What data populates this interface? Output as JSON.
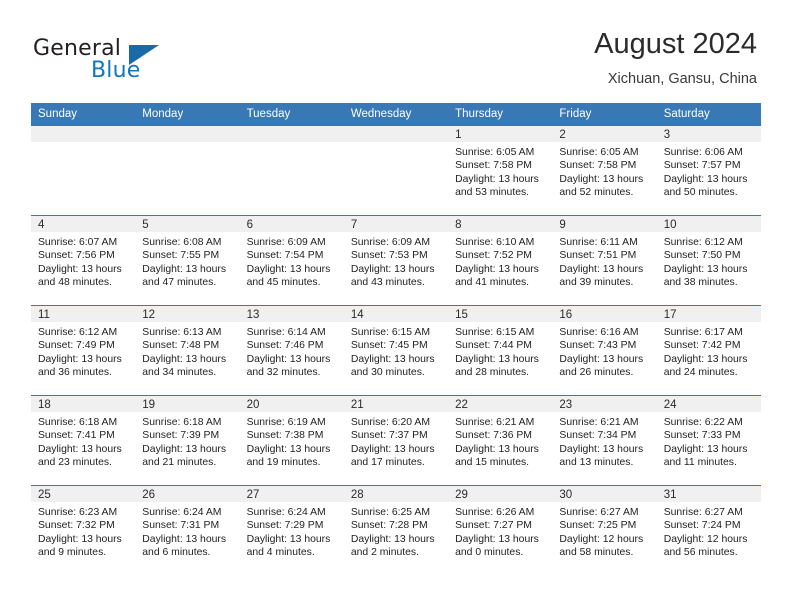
{
  "brand": {
    "name_part1": "General",
    "name_part2": "Blue",
    "colors": {
      "dark": "#231f20",
      "blue": "#1277bc",
      "triangle": "#1a6aa8"
    }
  },
  "header": {
    "title": "August 2024",
    "location": "Xichuan, Gansu, China"
  },
  "theme": {
    "header_row_bg": "#3878b4",
    "daynum_band_bg": "#f0f0f0",
    "row_divider": "#3878b4"
  },
  "weekdays": [
    "Sunday",
    "Monday",
    "Tuesday",
    "Wednesday",
    "Thursday",
    "Friday",
    "Saturday"
  ],
  "labels": {
    "sunrise_prefix": "Sunrise:",
    "sunset_prefix": "Sunset:",
    "daylight_prefix": "Daylight:"
  },
  "weeks": [
    [
      {
        "empty": true
      },
      {
        "empty": true
      },
      {
        "empty": true
      },
      {
        "empty": true
      },
      {
        "day": "1",
        "sunrise": "Sunrise: 6:05 AM",
        "sunset": "Sunset: 7:58 PM",
        "daylight_line1": "Daylight: 13 hours",
        "daylight_line2": "and 53 minutes."
      },
      {
        "day": "2",
        "sunrise": "Sunrise: 6:05 AM",
        "sunset": "Sunset: 7:58 PM",
        "daylight_line1": "Daylight: 13 hours",
        "daylight_line2": "and 52 minutes."
      },
      {
        "day": "3",
        "sunrise": "Sunrise: 6:06 AM",
        "sunset": "Sunset: 7:57 PM",
        "daylight_line1": "Daylight: 13 hours",
        "daylight_line2": "and 50 minutes."
      }
    ],
    [
      {
        "day": "4",
        "sunrise": "Sunrise: 6:07 AM",
        "sunset": "Sunset: 7:56 PM",
        "daylight_line1": "Daylight: 13 hours",
        "daylight_line2": "and 48 minutes."
      },
      {
        "day": "5",
        "sunrise": "Sunrise: 6:08 AM",
        "sunset": "Sunset: 7:55 PM",
        "daylight_line1": "Daylight: 13 hours",
        "daylight_line2": "and 47 minutes."
      },
      {
        "day": "6",
        "sunrise": "Sunrise: 6:09 AM",
        "sunset": "Sunset: 7:54 PM",
        "daylight_line1": "Daylight: 13 hours",
        "daylight_line2": "and 45 minutes."
      },
      {
        "day": "7",
        "sunrise": "Sunrise: 6:09 AM",
        "sunset": "Sunset: 7:53 PM",
        "daylight_line1": "Daylight: 13 hours",
        "daylight_line2": "and 43 minutes."
      },
      {
        "day": "8",
        "sunrise": "Sunrise: 6:10 AM",
        "sunset": "Sunset: 7:52 PM",
        "daylight_line1": "Daylight: 13 hours",
        "daylight_line2": "and 41 minutes."
      },
      {
        "day": "9",
        "sunrise": "Sunrise: 6:11 AM",
        "sunset": "Sunset: 7:51 PM",
        "daylight_line1": "Daylight: 13 hours",
        "daylight_line2": "and 39 minutes."
      },
      {
        "day": "10",
        "sunrise": "Sunrise: 6:12 AM",
        "sunset": "Sunset: 7:50 PM",
        "daylight_line1": "Daylight: 13 hours",
        "daylight_line2": "and 38 minutes."
      }
    ],
    [
      {
        "day": "11",
        "sunrise": "Sunrise: 6:12 AM",
        "sunset": "Sunset: 7:49 PM",
        "daylight_line1": "Daylight: 13 hours",
        "daylight_line2": "and 36 minutes."
      },
      {
        "day": "12",
        "sunrise": "Sunrise: 6:13 AM",
        "sunset": "Sunset: 7:48 PM",
        "daylight_line1": "Daylight: 13 hours",
        "daylight_line2": "and 34 minutes."
      },
      {
        "day": "13",
        "sunrise": "Sunrise: 6:14 AM",
        "sunset": "Sunset: 7:46 PM",
        "daylight_line1": "Daylight: 13 hours",
        "daylight_line2": "and 32 minutes."
      },
      {
        "day": "14",
        "sunrise": "Sunrise: 6:15 AM",
        "sunset": "Sunset: 7:45 PM",
        "daylight_line1": "Daylight: 13 hours",
        "daylight_line2": "and 30 minutes."
      },
      {
        "day": "15",
        "sunrise": "Sunrise: 6:15 AM",
        "sunset": "Sunset: 7:44 PM",
        "daylight_line1": "Daylight: 13 hours",
        "daylight_line2": "and 28 minutes."
      },
      {
        "day": "16",
        "sunrise": "Sunrise: 6:16 AM",
        "sunset": "Sunset: 7:43 PM",
        "daylight_line1": "Daylight: 13 hours",
        "daylight_line2": "and 26 minutes."
      },
      {
        "day": "17",
        "sunrise": "Sunrise: 6:17 AM",
        "sunset": "Sunset: 7:42 PM",
        "daylight_line1": "Daylight: 13 hours",
        "daylight_line2": "and 24 minutes."
      }
    ],
    [
      {
        "day": "18",
        "sunrise": "Sunrise: 6:18 AM",
        "sunset": "Sunset: 7:41 PM",
        "daylight_line1": "Daylight: 13 hours",
        "daylight_line2": "and 23 minutes."
      },
      {
        "day": "19",
        "sunrise": "Sunrise: 6:18 AM",
        "sunset": "Sunset: 7:39 PM",
        "daylight_line1": "Daylight: 13 hours",
        "daylight_line2": "and 21 minutes."
      },
      {
        "day": "20",
        "sunrise": "Sunrise: 6:19 AM",
        "sunset": "Sunset: 7:38 PM",
        "daylight_line1": "Daylight: 13 hours",
        "daylight_line2": "and 19 minutes."
      },
      {
        "day": "21",
        "sunrise": "Sunrise: 6:20 AM",
        "sunset": "Sunset: 7:37 PM",
        "daylight_line1": "Daylight: 13 hours",
        "daylight_line2": "and 17 minutes."
      },
      {
        "day": "22",
        "sunrise": "Sunrise: 6:21 AM",
        "sunset": "Sunset: 7:36 PM",
        "daylight_line1": "Daylight: 13 hours",
        "daylight_line2": "and 15 minutes."
      },
      {
        "day": "23",
        "sunrise": "Sunrise: 6:21 AM",
        "sunset": "Sunset: 7:34 PM",
        "daylight_line1": "Daylight: 13 hours",
        "daylight_line2": "and 13 minutes."
      },
      {
        "day": "24",
        "sunrise": "Sunrise: 6:22 AM",
        "sunset": "Sunset: 7:33 PM",
        "daylight_line1": "Daylight: 13 hours",
        "daylight_line2": "and 11 minutes."
      }
    ],
    [
      {
        "day": "25",
        "sunrise": "Sunrise: 6:23 AM",
        "sunset": "Sunset: 7:32 PM",
        "daylight_line1": "Daylight: 13 hours",
        "daylight_line2": "and 9 minutes."
      },
      {
        "day": "26",
        "sunrise": "Sunrise: 6:24 AM",
        "sunset": "Sunset: 7:31 PM",
        "daylight_line1": "Daylight: 13 hours",
        "daylight_line2": "and 6 minutes."
      },
      {
        "day": "27",
        "sunrise": "Sunrise: 6:24 AM",
        "sunset": "Sunset: 7:29 PM",
        "daylight_line1": "Daylight: 13 hours",
        "daylight_line2": "and 4 minutes."
      },
      {
        "day": "28",
        "sunrise": "Sunrise: 6:25 AM",
        "sunset": "Sunset: 7:28 PM",
        "daylight_line1": "Daylight: 13 hours",
        "daylight_line2": "and 2 minutes."
      },
      {
        "day": "29",
        "sunrise": "Sunrise: 6:26 AM",
        "sunset": "Sunset: 7:27 PM",
        "daylight_line1": "Daylight: 13 hours",
        "daylight_line2": "and 0 minutes."
      },
      {
        "day": "30",
        "sunrise": "Sunrise: 6:27 AM",
        "sunset": "Sunset: 7:25 PM",
        "daylight_line1": "Daylight: 12 hours",
        "daylight_line2": "and 58 minutes."
      },
      {
        "day": "31",
        "sunrise": "Sunrise: 6:27 AM",
        "sunset": "Sunset: 7:24 PM",
        "daylight_line1": "Daylight: 12 hours",
        "daylight_line2": "and 56 minutes."
      }
    ]
  ]
}
